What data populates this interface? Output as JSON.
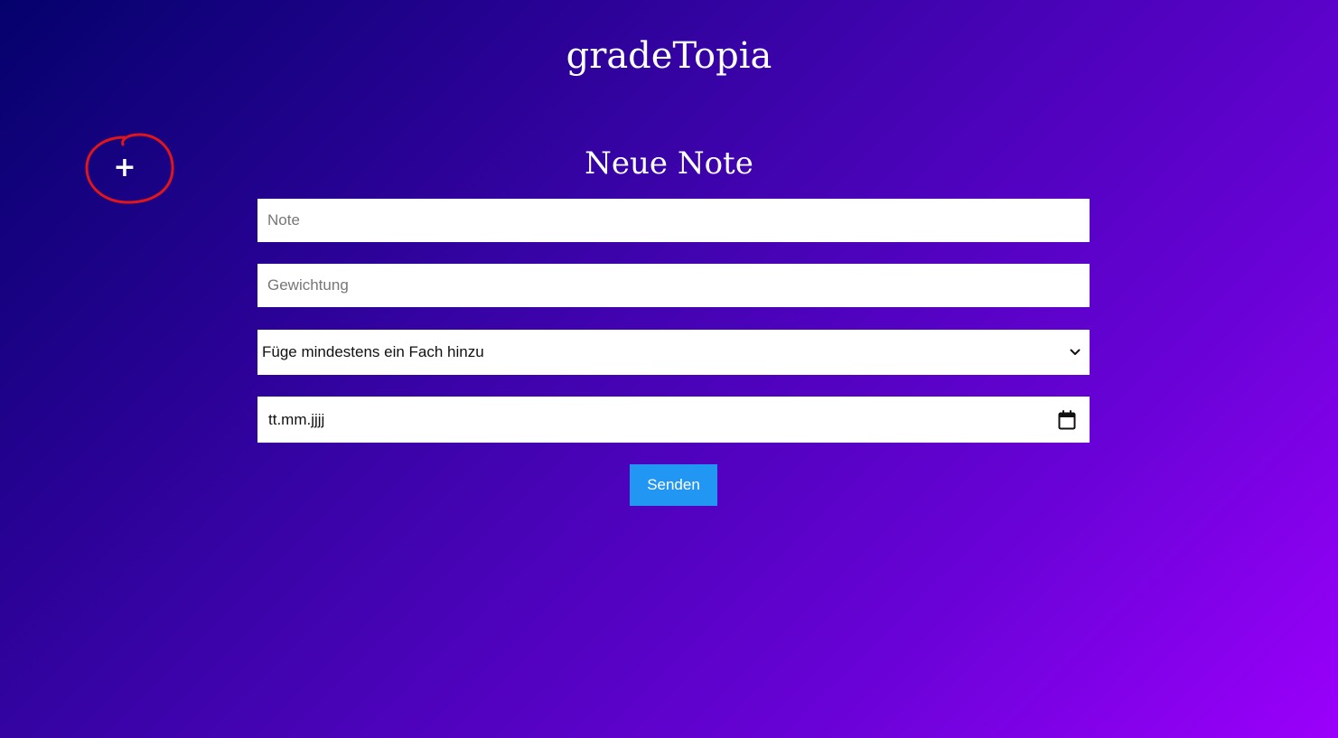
{
  "header": {
    "title": "gradeTopia"
  },
  "sidebar": {
    "add_label": "+"
  },
  "form": {
    "title": "Neue Note",
    "note_placeholder": "Note",
    "weight_placeholder": "Gewichtung",
    "subject_selected": "Füge mindestens ein Fach hinzu",
    "date_placeholder": "tt.mm.jjjj",
    "submit_label": "Senden"
  },
  "colors": {
    "background_start": "#04016c",
    "background_end": "#9b00fb",
    "submit_button": "#2196f3",
    "annotation": "#e0161b"
  },
  "icons": {
    "add": "plus-icon",
    "select": "chevron-down-icon",
    "date": "calendar-icon"
  }
}
